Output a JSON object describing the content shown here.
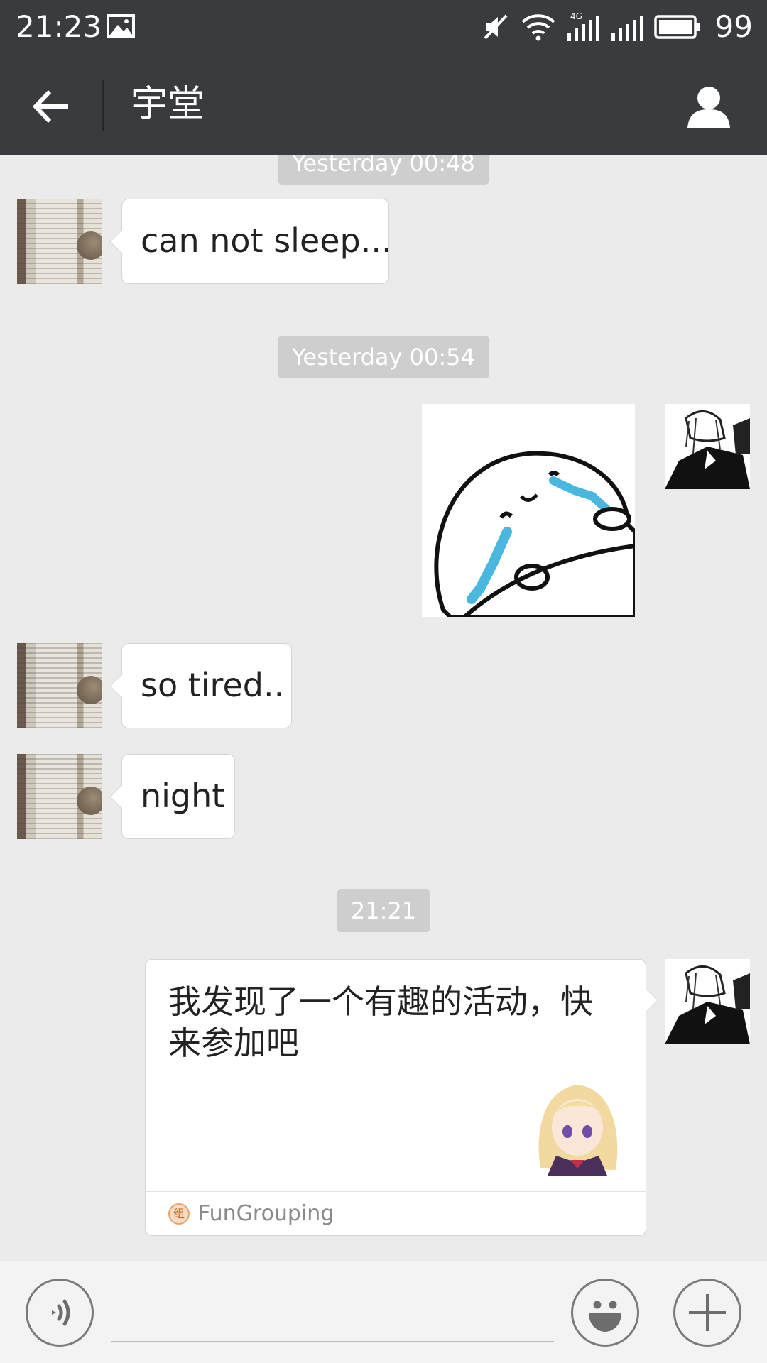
{
  "status_bar": {
    "time": "21:23",
    "battery": "99",
    "icons": [
      "image-icon",
      "mute-icon",
      "wifi-icon",
      "signal-4g-icon",
      "signal-icon",
      "battery-icon"
    ],
    "network_label": "4G"
  },
  "header": {
    "title": "宇堂",
    "back_icon": "back-arrow-icon",
    "profile_icon": "person-icon",
    "background": "#3a3b3f"
  },
  "chat": {
    "background": "#ebebeb",
    "messages": [
      {
        "type": "timestamp",
        "text": "Yesterday 00:48"
      },
      {
        "type": "text",
        "from": "other",
        "text": "can not sleep..."
      },
      {
        "type": "timestamp",
        "text": "Yesterday 00:54"
      },
      {
        "type": "sticker",
        "from": "me"
      },
      {
        "type": "text",
        "from": "other",
        "text": "so tired.."
      },
      {
        "type": "text",
        "from": "other",
        "text": "night"
      },
      {
        "type": "timestamp",
        "text": "21:21"
      },
      {
        "type": "card",
        "from": "me",
        "text": "我发现了一个有趣的活动，快来参加吧",
        "app_name": "FunGrouping",
        "app_icon_char": "组"
      }
    ]
  },
  "input_bar": {
    "placeholder": "",
    "voice_icon": "voice-icon",
    "emoji_icon": "emoji-icon",
    "plus_icon": "plus-icon"
  }
}
